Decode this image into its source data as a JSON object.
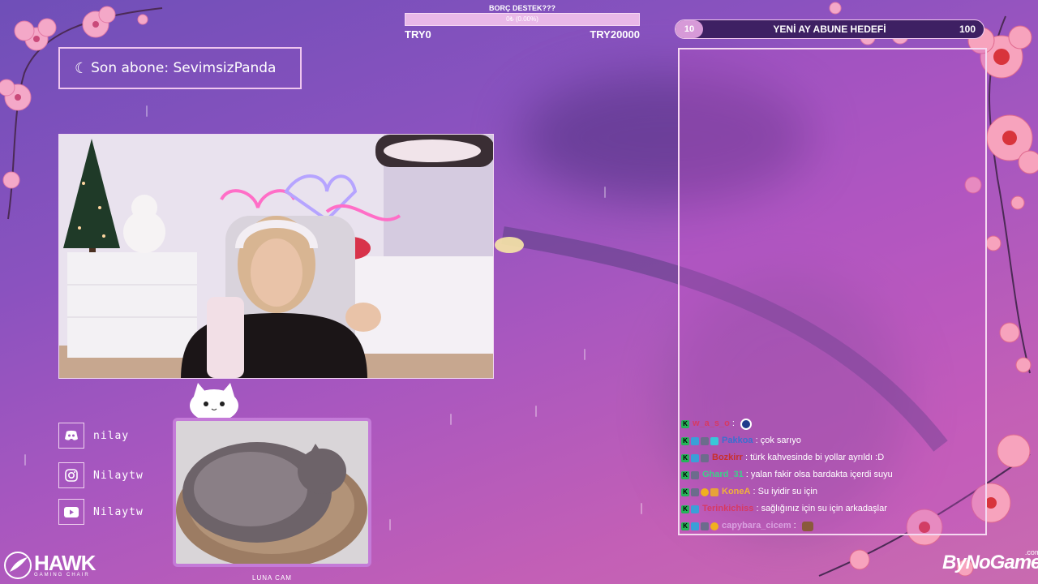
{
  "donation": {
    "title": "BORÇ DESTEK???",
    "percent_text": "0₺ (0.00%)",
    "progress": 0.0,
    "min_label": "TRY0",
    "max_label": "TRY20000"
  },
  "sub_goal": {
    "start": "10",
    "label": "YENİ AY ABUNE HEDEFİ",
    "target": "100"
  },
  "last_sub": {
    "text": "Son abone: SevimsizPanda"
  },
  "socials": [
    {
      "icon": "discord-icon",
      "handle": "nilay"
    },
    {
      "icon": "instagram-icon",
      "handle": "Nilaytw"
    },
    {
      "icon": "youtube-icon",
      "handle": "Nilaytw"
    }
  ],
  "cat_cam": {
    "label": "LUNA CAM"
  },
  "chat": [
    {
      "user": "w_a_s_o",
      "color": "#d63a63",
      "text": ""
    },
    {
      "user": "Pakkoa",
      "color": "#3a6fd0",
      "text": "çok sarıyo"
    },
    {
      "user": "Bozkirr",
      "color": "#c9302c",
      "text": "türk kahvesinde bi yollar ayrıldı :D"
    },
    {
      "user": "Ghard_31",
      "color": "#3fd08a",
      "text": "yalan fakir olsa bardakta içerdi suyu"
    },
    {
      "user": "KoneA",
      "color": "#f2b13a",
      "text": "Su iyidir su için"
    },
    {
      "user": "Terinkichiss",
      "color": "#d63a63",
      "text": "sağlığınız için su için arkadaşlar"
    },
    {
      "user": "capybara_cicem",
      "color": "#d9a0e0",
      "text": ""
    }
  ],
  "brands": {
    "left_logo": "HAWK",
    "left_sub": "GAMING CHAIR",
    "right_logo": "ByNoGame",
    "right_sub": ".com"
  }
}
